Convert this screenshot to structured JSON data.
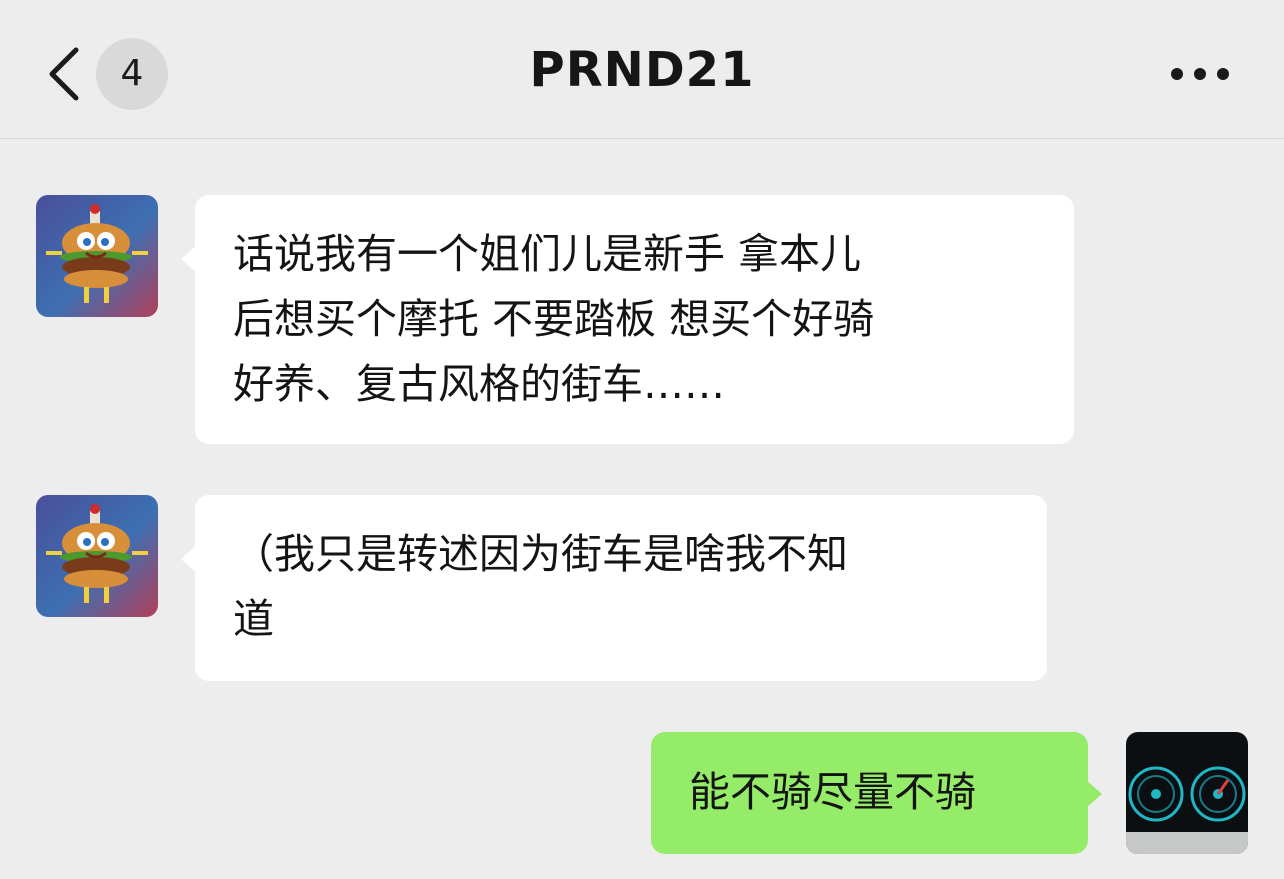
{
  "header": {
    "title": "PRND21",
    "unread_count": "4",
    "back_icon": "chevron-left-icon",
    "more_icon": "more-horizontal-icon"
  },
  "messages": [
    {
      "sender": "contact",
      "avatar": "spongebob-burger-avatar",
      "lines": [
        "话说我有一个姐们儿是新手 拿本儿",
        "后想买个摩托 不要踏板 想买个好骑",
        "好养、复古风格的街车……"
      ]
    },
    {
      "sender": "contact",
      "avatar": "spongebob-burger-avatar",
      "lines": [
        "（我只是转述因为街车是啥我不知",
        "道"
      ]
    },
    {
      "sender": "me",
      "avatar": "speedometer-avatar",
      "lines": [
        "能不骑尽量不骑"
      ]
    }
  ],
  "colors": {
    "background": "#ededed",
    "incoming_bubble": "#ffffff",
    "outgoing_bubble": "#95ec69"
  }
}
